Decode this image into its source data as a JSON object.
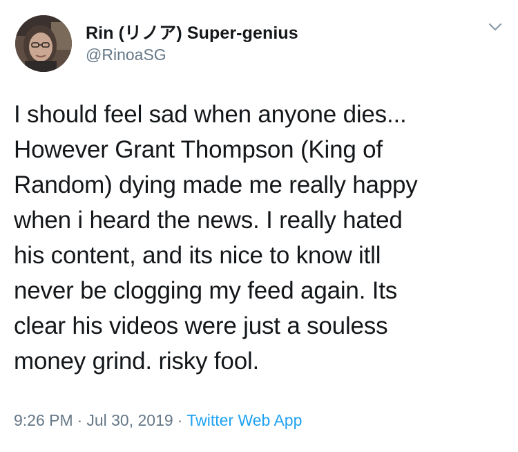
{
  "author": {
    "display_name": "Rin (リノア) Super-genius",
    "handle": "@RinoaSG"
  },
  "tweet": {
    "text": "I should feel sad when anyone dies...\nHowever Grant Thompson (King of\nRandom) dying made me really happy\nwhen i heard the news. I really hated\nhis content, and its nice to know itll\nnever be clogging my feed again. Its\nclear his videos were just a souless\nmoney grind. risky fool.",
    "time": "9:26 PM",
    "separator": "·",
    "date": "Jul 30, 2019",
    "source": "Twitter Web App"
  },
  "icons": {
    "menu": "chevron-down-icon"
  },
  "colors": {
    "text": "#14171a",
    "secondary": "#657786",
    "accent": "#1da1f2",
    "background": "#ffffff"
  }
}
